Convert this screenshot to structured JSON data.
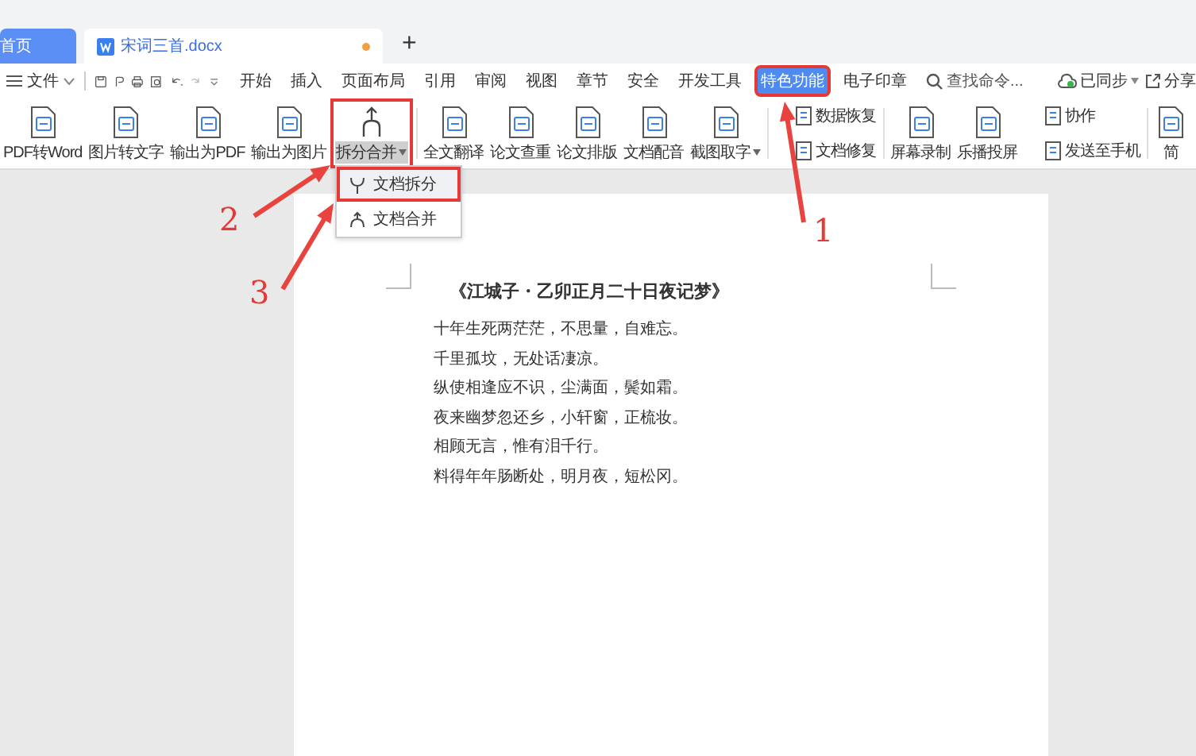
{
  "tabs": [
    {
      "label": "首页",
      "kind": "home",
      "selected": false
    },
    {
      "label": "宋词三首.docx",
      "kind": "doc",
      "selected": true,
      "unsaved": true
    }
  ],
  "new_tab": "+",
  "menu": {
    "file": "文件",
    "items": [
      {
        "label": "开始",
        "selected": false,
        "boxed": false
      },
      {
        "label": "插入",
        "selected": false,
        "boxed": false
      },
      {
        "label": "页面布局",
        "selected": false,
        "boxed": false
      },
      {
        "label": "引用",
        "selected": false,
        "boxed": false
      },
      {
        "label": "审阅",
        "selected": false,
        "boxed": false
      },
      {
        "label": "视图",
        "selected": false,
        "boxed": false
      },
      {
        "label": "章节",
        "selected": false,
        "boxed": false
      },
      {
        "label": "安全",
        "selected": false,
        "boxed": false
      },
      {
        "label": "开发工具",
        "selected": false,
        "boxed": false
      },
      {
        "label": "特色功能",
        "selected": true,
        "boxed": true
      },
      {
        "label": "电子印章",
        "selected": false,
        "boxed": false
      }
    ],
    "search_placeholder": "查找命令...",
    "sync": "已同步",
    "share": "分享"
  },
  "ribbon": [
    {
      "kind": "large",
      "label": "PDF转Word",
      "dropdown": false,
      "boxed": false,
      "pressed": false
    },
    {
      "kind": "large",
      "label": "图片转文字",
      "dropdown": false,
      "boxed": false,
      "pressed": false
    },
    {
      "kind": "large",
      "label": "输出为PDF",
      "dropdown": false,
      "boxed": false,
      "pressed": false
    },
    {
      "kind": "large",
      "label": "输出为图片",
      "dropdown": false,
      "boxed": false,
      "pressed": false
    },
    {
      "kind": "large",
      "label": "拆分合并",
      "dropdown": true,
      "boxed": true,
      "pressed": true
    },
    {
      "kind": "separator"
    },
    {
      "kind": "large",
      "label": "全文翻译",
      "dropdown": false,
      "boxed": false,
      "pressed": false
    },
    {
      "kind": "large",
      "label": "论文查重",
      "dropdown": false,
      "boxed": false,
      "pressed": false
    },
    {
      "kind": "large",
      "label": "论文排版",
      "dropdown": false,
      "boxed": false,
      "pressed": false
    },
    {
      "kind": "large",
      "label": "文档配音",
      "dropdown": false,
      "boxed": false,
      "pressed": false
    },
    {
      "kind": "large",
      "label": "截图取字",
      "dropdown": true,
      "boxed": false,
      "pressed": false
    },
    {
      "kind": "separator"
    },
    {
      "kind": "stack",
      "items": [
        "数据恢复",
        "文档修复"
      ]
    },
    {
      "kind": "separator"
    },
    {
      "kind": "large",
      "label": "屏幕录制",
      "dropdown": false,
      "boxed": false,
      "pressed": false
    },
    {
      "kind": "large",
      "label": "乐播投屏",
      "dropdown": false,
      "boxed": false,
      "pressed": false
    },
    {
      "kind": "stack",
      "items": [
        "协作",
        "发送至手机"
      ]
    },
    {
      "kind": "separator"
    },
    {
      "kind": "large",
      "label": "简",
      "dropdown": false,
      "boxed": false,
      "pressed": false
    }
  ],
  "dropdown_menu": [
    {
      "label": "文档拆分",
      "selected": true,
      "boxed": true
    },
    {
      "label": "文档合并",
      "selected": false,
      "boxed": false
    }
  ],
  "document": {
    "title": "《江城子・乙卯正月二十日夜记梦》",
    "lines": [
      "十年生死两茫茫，不思量，自难忘。",
      "千里孤坟，无处话凄凉。",
      "纵使相逢应不识，尘满面，鬓如霜。",
      "夜来幽梦忽还乡，小轩窗，正梳妆。",
      "相顾无言，惟有泪千行。",
      "料得年年肠断处，明月夜，短松冈。"
    ]
  },
  "callouts": [
    "1",
    "2",
    "3"
  ]
}
